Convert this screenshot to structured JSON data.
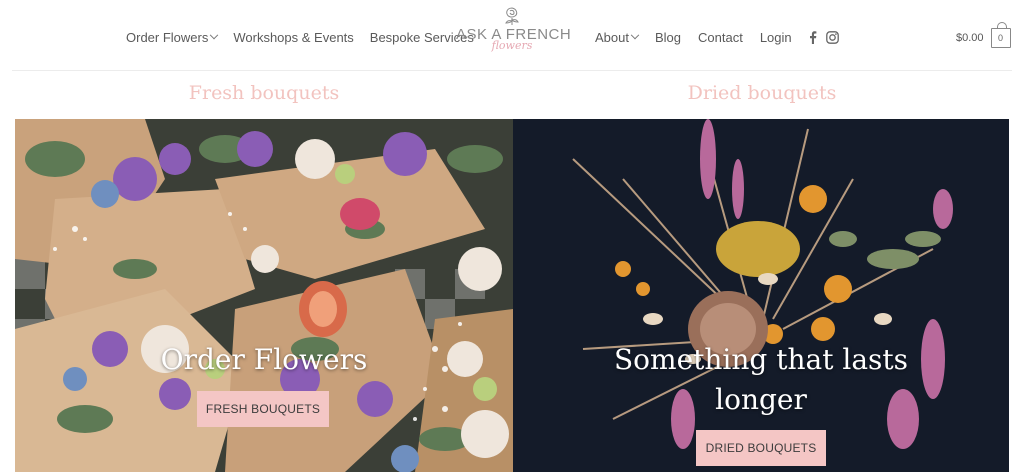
{
  "header": {
    "nav_left": [
      {
        "label": "Order Flowers",
        "has_dropdown": true
      },
      {
        "label": "Workshops & Events",
        "has_dropdown": false
      },
      {
        "label": "Bespoke Services",
        "has_dropdown": false
      }
    ],
    "logo": {
      "main": "ASK A FRENCH",
      "sub": "flowers"
    },
    "nav_right": [
      {
        "label": "About",
        "has_dropdown": true
      },
      {
        "label": "Blog",
        "has_dropdown": false
      },
      {
        "label": "Contact",
        "has_dropdown": false
      },
      {
        "label": "Login",
        "has_dropdown": false
      }
    ],
    "social": [
      "facebook-icon",
      "instagram-icon"
    ],
    "cart": {
      "total": "$0.00",
      "count": "0"
    }
  },
  "sections": {
    "left": {
      "title": "Fresh bouquets",
      "overlay": "Order Flowers",
      "button": "FRESH BOUQUETS"
    },
    "right": {
      "title": "Dried bouquets",
      "overlay_line1": "Something that lasts",
      "overlay_line2": "longer",
      "button": "DRIED BOUQUETS"
    }
  },
  "colors": {
    "accent_pink": "#f4c6c5",
    "title_pink": "#f2c3bf",
    "logo_pink": "#e6a9b3"
  }
}
